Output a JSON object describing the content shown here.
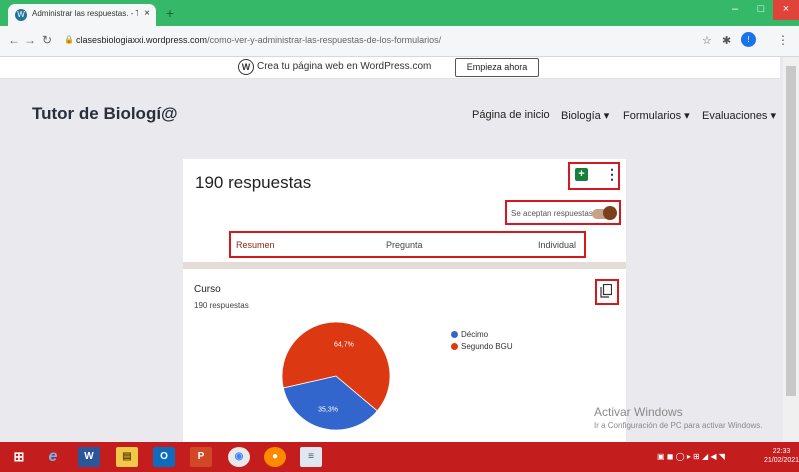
{
  "browser": {
    "tab_title": "Administrar las respuestas. - Tut",
    "tab_close": "×",
    "new_tab": "+",
    "url_host": "clasesbiologiaxxi.wordpress.com",
    "url_path": "/como-ver-y-administrar-las-respuestas-de-los-formularios/",
    "profile_initial": "!",
    "window_min": "–",
    "window_max": "□",
    "window_close": "×"
  },
  "banner": {
    "text": "Crea tu página web en WordPress.com",
    "button": "Empieza ahora"
  },
  "site": {
    "title": "Tutor de Biologí@",
    "nav": [
      "Página de inicio",
      "Biología ▾",
      "Formularios ▾",
      "Evaluaciones ▾"
    ]
  },
  "form": {
    "responses_title": "190 respuestas",
    "accepting_label": "Se aceptan respuestas",
    "tabs": [
      "Resumen",
      "Pregunta",
      "Individual"
    ],
    "question": {
      "title": "Curso",
      "count": "190 respuestas"
    }
  },
  "chart_data": {
    "type": "pie",
    "values": [
      35.3,
      64.7
    ],
    "categories": [
      "Décimo",
      "Segundo BGU"
    ],
    "labels": [
      "35,3%",
      "64,7%"
    ],
    "colors": [
      "#3366cc",
      "#dc3912"
    ],
    "legend": "top-right"
  },
  "watermark": {
    "line1": "Activar Windows",
    "line2": "Ir a Configuración de PC para activar Windows."
  },
  "taskbar": {
    "time": "22:33",
    "date": "21/02/2021"
  },
  "colors": {
    "highlight_border": "#d3181e",
    "chrome_green": "#35b867",
    "taskbar_red": "#c41d1d",
    "toggle_on": "#7b3f1b"
  }
}
